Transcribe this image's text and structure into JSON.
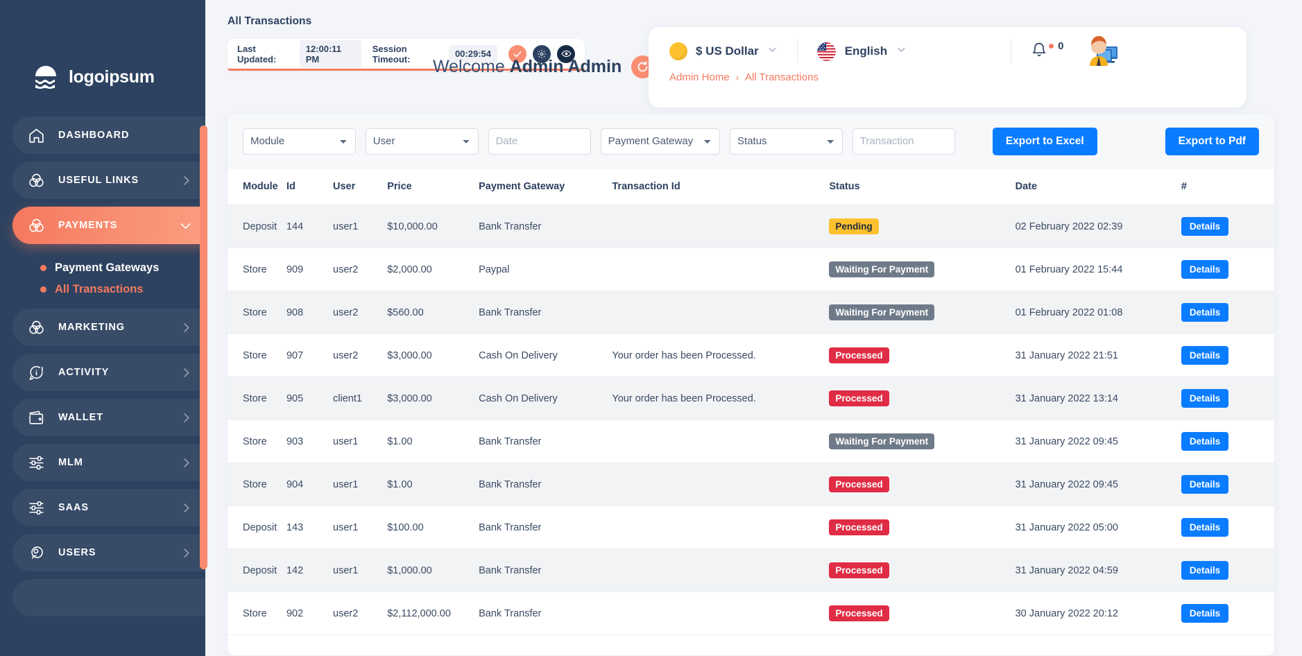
{
  "brand": {
    "name": "logoipsum"
  },
  "colors": {
    "sidebar_bg": "#2d4260",
    "accent_coral": "#f4795f",
    "blue": "#0a7cff",
    "pending": "#fdc02f",
    "waiting": "#6f7a89",
    "processed": "#e02c44"
  },
  "sidebar": {
    "items": [
      {
        "label": "DASHBOARD",
        "icon": "home-icon",
        "chevron": false,
        "active": false
      },
      {
        "label": "USEFUL LINKS",
        "icon": "venn-icon",
        "chevron": true,
        "active": false
      },
      {
        "label": "PAYMENTS",
        "icon": "venn-icon",
        "chevron": true,
        "active": true
      },
      {
        "label": "MARKETING",
        "icon": "venn-icon",
        "chevron": true,
        "active": false
      },
      {
        "label": "ACTIVITY",
        "icon": "info-chat-icon",
        "chevron": true,
        "active": false
      },
      {
        "label": "WALLET",
        "icon": "wallet-icon",
        "chevron": true,
        "active": false
      },
      {
        "label": "MLM",
        "icon": "sliders-icon",
        "chevron": true,
        "active": false
      },
      {
        "label": "SAAS",
        "icon": "sliders-icon",
        "chevron": true,
        "active": false
      },
      {
        "label": "USERS",
        "icon": "users-icon",
        "chevron": true,
        "active": false
      }
    ],
    "submenu": [
      {
        "label": "Payment Gateways",
        "active": false
      },
      {
        "label": "All Transactions",
        "active": true
      }
    ]
  },
  "topbar": {
    "page_title": "All Transactions",
    "welcome_prefix": "Welcome ",
    "welcome_name": "Admin Admin",
    "refresh_icon": "refresh-icon",
    "session": {
      "last_updated_label": "Last Updated:",
      "last_updated_value": "12:00:11 PM",
      "timeout_label": "Session Timeout:",
      "timeout_value": "00:29:54",
      "buttons": [
        {
          "icon": "check-icon"
        },
        {
          "icon": "gear-icon"
        },
        {
          "icon": "eye-icon"
        }
      ]
    }
  },
  "header": {
    "currency": "$ US Dollar",
    "currency_icon": "coin-icon",
    "language": "English",
    "language_icon": "us-flag-icon",
    "bell_icon": "bell-icon",
    "notification_count": "0",
    "avatar_icon": "user-avatar",
    "breadcrumb": [
      {
        "label": "Admin Home"
      },
      {
        "label": "All Transactions"
      }
    ],
    "breadcrumb_separator": "›"
  },
  "filters": {
    "module": {
      "value": "Module"
    },
    "user": {
      "value": "User"
    },
    "date": {
      "value": "",
      "placeholder": "Date"
    },
    "payment_gateway": {
      "value": "Payment Gateway"
    },
    "status": {
      "value": "Status"
    },
    "transaction": {
      "value": "",
      "placeholder": "Transaction"
    },
    "export_excel": "Export to Excel",
    "export_pdf": "Export to Pdf"
  },
  "table": {
    "columns": [
      "Module",
      "Id",
      "User",
      "Price",
      "Payment Gateway",
      "Transaction Id",
      "Status",
      "Date",
      "#"
    ],
    "action_label": "Details",
    "rows": [
      {
        "module": "Deposit",
        "id": "144",
        "user": "user1",
        "price": "$10,000.00",
        "gateway": "Bank Transfer",
        "txn": "",
        "status": "Pending",
        "status_type": "pending",
        "date": "02 February 2022 02:39"
      },
      {
        "module": "Store",
        "id": "909",
        "user": "user2",
        "price": "$2,000.00",
        "gateway": "Paypal",
        "txn": "",
        "status": "Waiting For Payment",
        "status_type": "waiting",
        "date": "01 February 2022 15:44"
      },
      {
        "module": "Store",
        "id": "908",
        "user": "user2",
        "price": "$560.00",
        "gateway": "Bank Transfer",
        "txn": "",
        "status": "Waiting For Payment",
        "status_type": "waiting",
        "date": "01 February 2022 01:08"
      },
      {
        "module": "Store",
        "id": "907",
        "user": "user2",
        "price": "$3,000.00",
        "gateway": "Cash On Delivery",
        "txn": "Your order has been Processed.",
        "status": "Processed",
        "status_type": "processed",
        "date": "31 January 2022 21:51"
      },
      {
        "module": "Store",
        "id": "905",
        "user": "client1",
        "price": "$3,000.00",
        "gateway": "Cash On Delivery",
        "txn": "Your order has been Processed.",
        "status": "Processed",
        "status_type": "processed",
        "date": "31 January 2022 13:14"
      },
      {
        "module": "Store",
        "id": "903",
        "user": "user1",
        "price": "$1.00",
        "gateway": "Bank Transfer",
        "txn": "",
        "status": "Waiting For Payment",
        "status_type": "waiting",
        "date": "31 January 2022 09:45"
      },
      {
        "module": "Store",
        "id": "904",
        "user": "user1",
        "price": "$1.00",
        "gateway": "Bank Transfer",
        "txn": "",
        "status": "Processed",
        "status_type": "processed",
        "date": "31 January 2022 09:45"
      },
      {
        "module": "Deposit",
        "id": "143",
        "user": "user1",
        "price": "$100.00",
        "gateway": "Bank Transfer",
        "txn": "",
        "status": "Processed",
        "status_type": "processed",
        "date": "31 January 2022 05:00"
      },
      {
        "module": "Deposit",
        "id": "142",
        "user": "user1",
        "price": "$1,000.00",
        "gateway": "Bank Transfer",
        "txn": "",
        "status": "Processed",
        "status_type": "processed",
        "date": "31 January 2022 04:59"
      },
      {
        "module": "Store",
        "id": "902",
        "user": "user2",
        "price": "$2,112,000.00",
        "gateway": "Bank Transfer",
        "txn": "",
        "status": "Processed",
        "status_type": "processed",
        "date": "30 January 2022 20:12"
      }
    ]
  }
}
